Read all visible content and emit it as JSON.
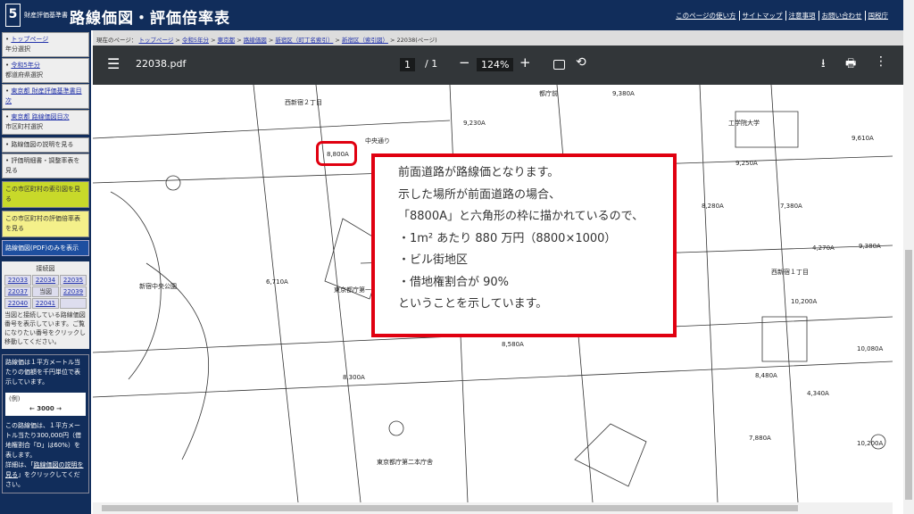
{
  "header": {
    "logo_num": "5",
    "logo_sub": "財産評価基準書",
    "title": "路線価図・評価倍率表",
    "links": [
      "このページの使い方",
      "サイトマップ",
      "注意事項",
      "お問い合わせ",
      "国税庁"
    ]
  },
  "sidebar": {
    "nav": [
      {
        "link": "トップページ",
        "sub": "年分選択"
      },
      {
        "link": "令和5年分",
        "sub": "都道府県選択"
      },
      {
        "link": "東京都 財産評価基準書目次",
        "sub": ""
      },
      {
        "link": "東京都 路線価図目次",
        "sub": "市区町村選択"
      }
    ],
    "items": [
      "路線価図の説明を見る",
      "評価明細書・調整率表を見る"
    ],
    "index_map": "この市区町村の索引図を見る",
    "multiplier": "この市区町村の評価倍率表を見る",
    "pdf_only": "路線価図(PDF)のみを表示",
    "adjacent": {
      "title": "接続図",
      "cells": [
        "22033",
        "22034",
        "22035",
        "22037",
        "当図",
        "22039",
        "22040",
        "22041",
        ""
      ],
      "note": "当図と接続している路線価図番号を表示しています。ご覧になりたい番号をクリックし移動してください。"
    },
    "info": {
      "text1": "路線価は１平方メートル当たりの価額を千円単位で表示しています。",
      "example_label": "(例)",
      "example_value": "← 3000 →",
      "text2": "この路線価は、１平方メートル当たり300,000円（借地権割合「D」は60%）を表します。",
      "text3a": "詳細は、「",
      "text3_link": "路線価図の説明を見る",
      "text3b": "」をクリックしてください。"
    }
  },
  "breadcrumb": {
    "prefix": "現在のページ：",
    "items": [
      "トップページ",
      "令和5年分",
      "東京都",
      "路線価図",
      "新宿区（町丁名索引）",
      "新宿区（索引図）"
    ],
    "current": "22038(ページ)"
  },
  "pdf": {
    "filename": "22038.pdf",
    "page": "1",
    "total": "/ 1",
    "zoom": "124%"
  },
  "map": {
    "labels": [
      "西新宿２丁目",
      "8,800A",
      "9,230A",
      "9,380A",
      "9,610A",
      "9,250A",
      "8,280A",
      "7,380A",
      "4,270A",
      "9,380A",
      "西新宿１丁目",
      "10,200A",
      "6,710A",
      "8,580A",
      "8,300A",
      "8,480A",
      "4,340A",
      "10,080A",
      "7,880A",
      "10,200A",
      "都庁前",
      "工学院大学",
      "新宿中央公園",
      "中央通り",
      "東京都庁第一本庁舎",
      "東京都庁第二本庁舎"
    ]
  },
  "callout": {
    "lines": [
      "前面道路が路線価となります。",
      "示した場所が前面道路の場合、",
      "「8800A」と六角形の枠に描かれているので、",
      "・1m² あたり 880 万円（8800×1000）",
      "・ビル街地区",
      "・借地権割合が 90%",
      "ということを示しています。"
    ]
  },
  "colors": {
    "header": "#112d5b",
    "highlight": "#e00010"
  }
}
